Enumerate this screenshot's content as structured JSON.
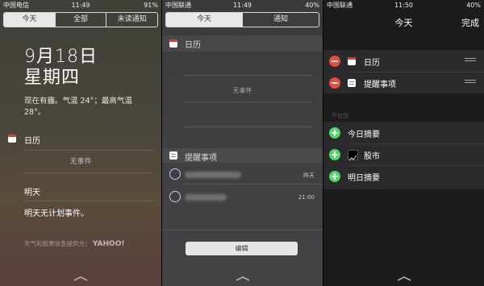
{
  "screen1": {
    "status": {
      "carrier": "中国电信",
      "time": "11:49",
      "battery": "91%"
    },
    "tabs": [
      "今天",
      "全部",
      "未读通知"
    ],
    "date": "9月18日",
    "weekday": "星期四",
    "weather_line1": "现在有霾。气温 24°；最高气温",
    "weather_line2": "28°。",
    "calendar_title": "日历",
    "no_events": "无事件",
    "tomorrow_title": "明天",
    "tomorrow_text": "明天无计划事件。",
    "footer": "天气和股票信息提供方：",
    "footer_brand": "YAHOO!"
  },
  "screen2": {
    "status": {
      "carrier": "中国联通",
      "time": "11:49",
      "battery": "40%"
    },
    "tabs": [
      "今天",
      "通知"
    ],
    "calendar_title": "日历",
    "no_events": "无事件",
    "reminders_title": "提醒事项",
    "reminders": [
      {
        "time": "昨天"
      },
      {
        "time": "21:00"
      }
    ],
    "edit_button": "编辑"
  },
  "screen3": {
    "status": {
      "carrier": "中国联通",
      "time": "11:50",
      "battery": "40%"
    },
    "title": "今天",
    "done": "完成",
    "included": [
      "日历",
      "提醒事项"
    ],
    "not_included_header": "不包括",
    "excluded": [
      "今日摘要",
      "股市",
      "明日摘要"
    ]
  },
  "colors": {
    "remove": "#e74b3c",
    "add": "#4cd964",
    "calendar_red": "#e33333"
  }
}
